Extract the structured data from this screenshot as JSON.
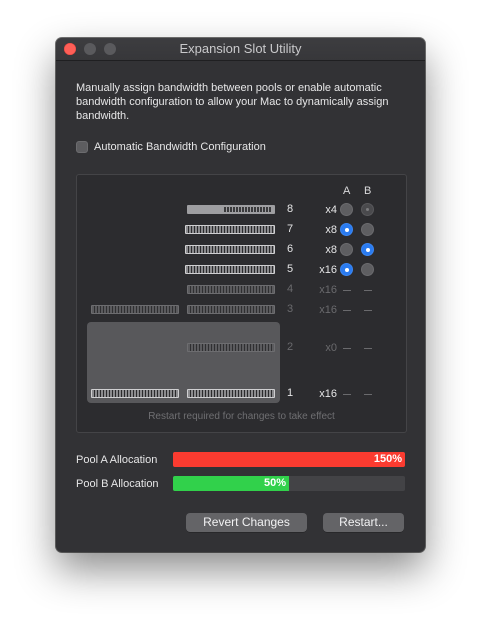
{
  "window": {
    "title": "Expansion Slot Utility"
  },
  "description": "Manually assign bandwidth between pools or enable automatic bandwidth configuration to allow your Mac to dynamically assign bandwidth.",
  "auto_config": {
    "label": "Automatic Bandwidth Configuration",
    "checked": false
  },
  "slots_panel": {
    "column_a": "A",
    "column_b": "B",
    "slots": [
      {
        "number": "8",
        "width": "x4",
        "pool_a": "off",
        "pool_b": "disabled-on"
      },
      {
        "number": "7",
        "width": "x8",
        "pool_a": "on",
        "pool_b": "off"
      },
      {
        "number": "6",
        "width": "x8",
        "pool_a": "off",
        "pool_b": "on"
      },
      {
        "number": "5",
        "width": "x16",
        "pool_a": "on",
        "pool_b": "off"
      },
      {
        "number": "4",
        "width": "x16",
        "pool_a": "none",
        "pool_b": "none"
      },
      {
        "number": "3",
        "width": "x16",
        "pool_a": "none",
        "pool_b": "none"
      },
      {
        "number": "2",
        "width": "x0",
        "pool_a": "none",
        "pool_b": "none"
      },
      {
        "number": "1",
        "width": "x16",
        "pool_a": "none",
        "pool_b": "none"
      }
    ],
    "note": "Restart required for changes to take effect"
  },
  "pools": [
    {
      "label": "Pool A Allocation",
      "value": "150%",
      "fill_fraction": 1.0,
      "color": "#fb3b30"
    },
    {
      "label": "Pool B Allocation",
      "value": "50%",
      "fill_fraction": 0.5,
      "color": "#31d14b"
    }
  ],
  "buttons": {
    "revert": "Revert Changes",
    "restart": "Restart..."
  }
}
